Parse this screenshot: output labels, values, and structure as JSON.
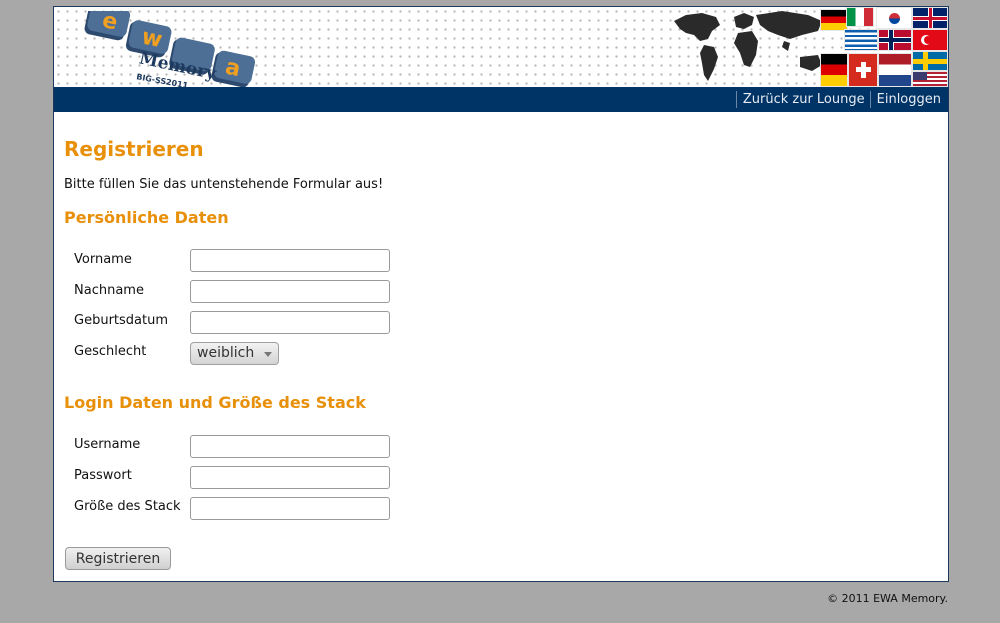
{
  "header": {
    "logo_text": "Memory",
    "logo_letters": [
      "e",
      "w",
      "a"
    ],
    "logo_subtitle": "BIG-SS2011",
    "flags": [
      "germany-flag",
      "italy-flag",
      "greece-flag",
      "south-korea-flag",
      "uk-flag",
      "norway-flag",
      "turkey-flag",
      "sweden-flag",
      "netherlands-flag",
      "usa-flag",
      "switzerland-flag"
    ]
  },
  "nav": {
    "back_to_lounge": "Zurück zur Lounge",
    "login": "Einloggen"
  },
  "form": {
    "title": "Registrieren",
    "intro": "Bitte füllen Sie das untenstehende Formular aus!",
    "personal_section": "Persönliche Daten",
    "first_name_label": "Vorname",
    "first_name_value": "",
    "last_name_label": "Nachname",
    "last_name_value": "",
    "birthdate_label": "Geburtsdatum",
    "birthdate_value": "",
    "gender_label": "Geschlecht",
    "gender_selected": "weiblich",
    "login_section": "Login Daten und Größe des Stack",
    "username_label": "Username",
    "username_value": "",
    "password_label": "Passwort",
    "password_value": "",
    "stack_size_label": "Größe des Stack",
    "stack_size_value": "",
    "submit_label": "Registrieren"
  },
  "footer": {
    "copyright": "© 2011 EWA Memory."
  },
  "colors": {
    "accent": "#e8900a",
    "navbar": "#003366",
    "background": "#a8a8a8"
  }
}
